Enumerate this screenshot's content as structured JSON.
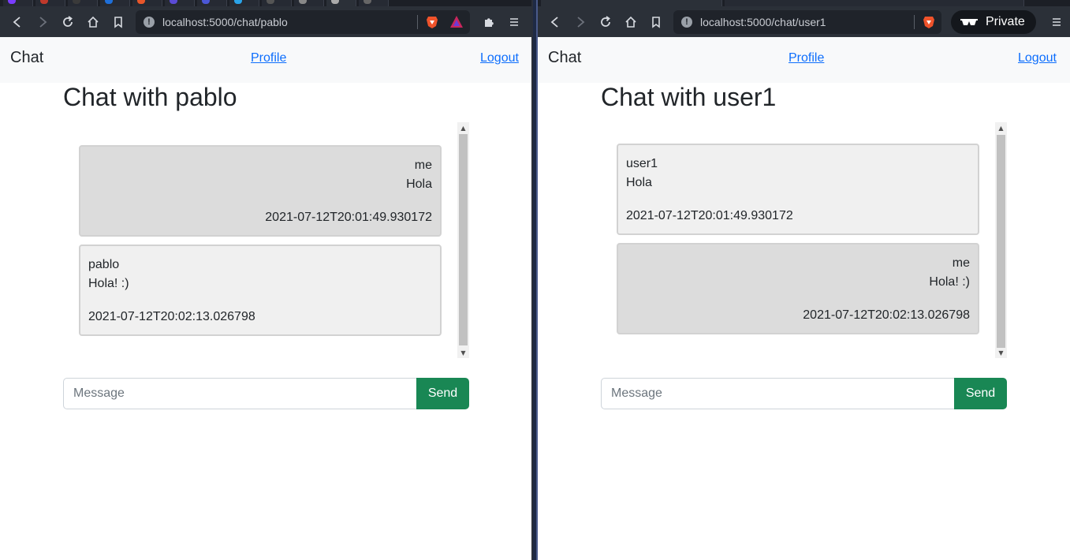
{
  "colors": {
    "link": "#0d6efd",
    "send_button": "#198754",
    "my_message_bg": "#dcdcdc",
    "other_message_bg": "#f0f0f0",
    "navbar_bg": "#f8f9fa",
    "browser_toolbar": "#2b3038"
  },
  "browser_left": {
    "url": "localhost:5000/chat/pablo",
    "icons": [
      "back-icon",
      "forward-icon",
      "reload-icon",
      "home-icon",
      "bookmark-icon",
      "site-info-icon",
      "brave-shields-icon",
      "brave-rewards-icon",
      "extensions-icon",
      "menu-icon"
    ]
  },
  "browser_right": {
    "url": "localhost:5000/chat/user1",
    "private_label": "Private",
    "icons": [
      "back-icon",
      "forward-icon",
      "reload-icon",
      "home-icon",
      "bookmark-icon",
      "site-info-icon",
      "brave-shields-icon",
      "private-glasses-icon",
      "menu-icon"
    ]
  },
  "left": {
    "navbar": {
      "brand": "Chat",
      "profile": "Profile",
      "logout": "Logout"
    },
    "title": "Chat with pablo",
    "messages": [
      {
        "sender": "me",
        "text": "Hola",
        "time": "2021-07-12T20:01:49.930172",
        "mine": true
      },
      {
        "sender": "pablo",
        "text": "Hola! :)",
        "time": "2021-07-12T20:02:13.026798",
        "mine": false
      }
    ],
    "composer": {
      "placeholder": "Message",
      "value": "",
      "send_label": "Send"
    }
  },
  "right": {
    "navbar": {
      "brand": "Chat",
      "profile": "Profile",
      "logout": "Logout"
    },
    "title": "Chat with user1",
    "messages": [
      {
        "sender": "user1",
        "text": "Hola",
        "time": "2021-07-12T20:01:49.930172",
        "mine": false
      },
      {
        "sender": "me",
        "text": "Hola! :)",
        "time": "2021-07-12T20:02:13.026798",
        "mine": true
      }
    ],
    "composer": {
      "placeholder": "Message",
      "value": "",
      "send_label": "Send"
    }
  }
}
